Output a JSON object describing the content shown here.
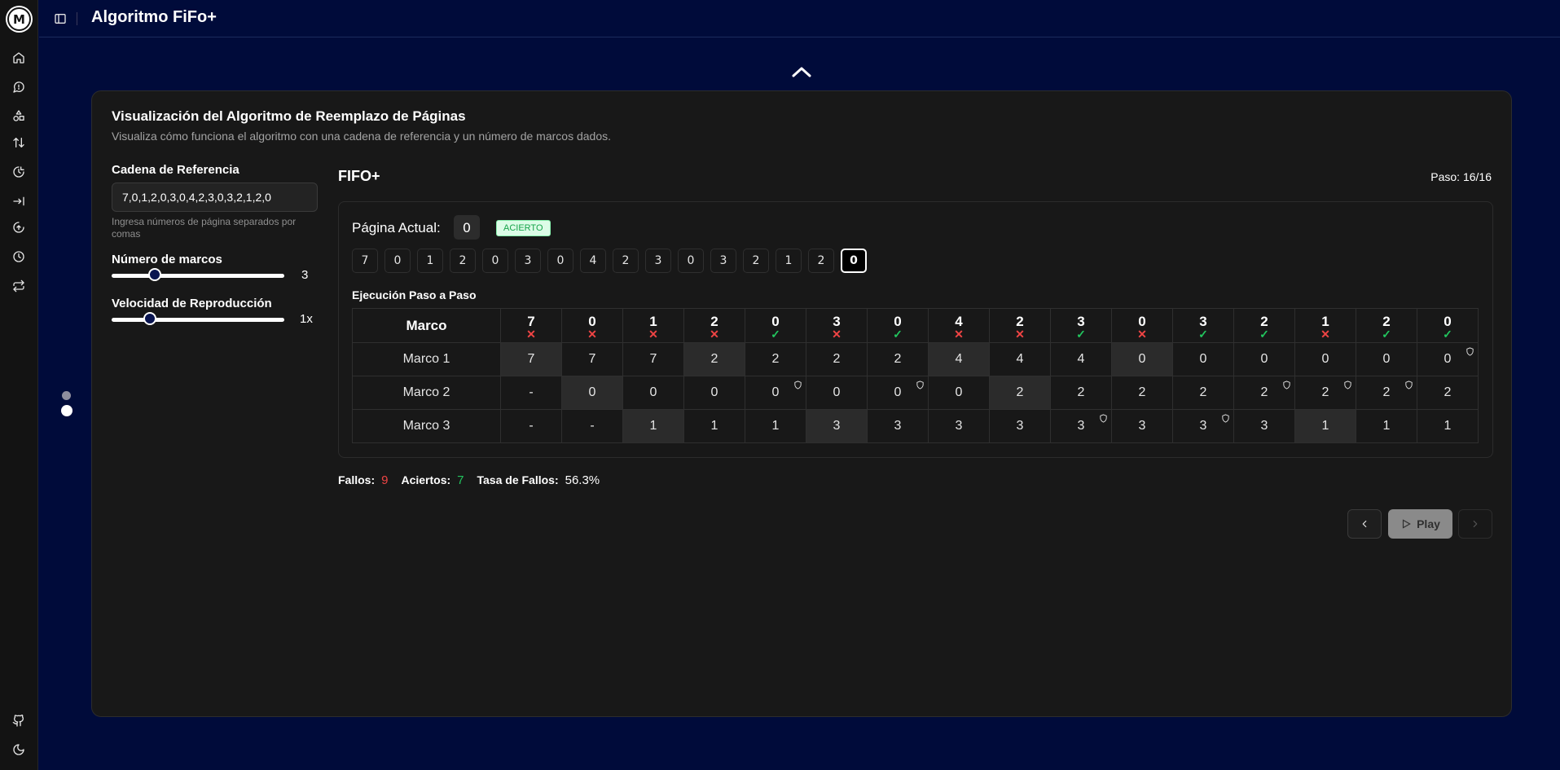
{
  "app": {
    "title": "Algoritmo FiFo+",
    "logo": "M"
  },
  "sidebar": {
    "items": [
      {
        "icon": "home-icon"
      },
      {
        "icon": "chat-icon"
      },
      {
        "icon": "shapes-icon"
      },
      {
        "icon": "swap-vertical-icon"
      },
      {
        "icon": "clock-pie-icon"
      },
      {
        "icon": "arrow-right-to-line-icon"
      },
      {
        "icon": "upload-clock-icon"
      },
      {
        "icon": "clock-icon"
      },
      {
        "icon": "repeat-icon"
      }
    ],
    "bottom": [
      {
        "icon": "github-icon"
      },
      {
        "icon": "moon-icon"
      }
    ]
  },
  "card": {
    "title": "Visualización del Algoritmo de Reemplazo de Páginas",
    "description": "Visualiza cómo funciona el algoritmo con una cadena de referencia y un número de marcos dados."
  },
  "controls": {
    "ref_label": "Cadena de Referencia",
    "ref_value": "7,0,1,2,0,3,0,4,2,3,0,3,2,1,2,0",
    "ref_hint": "Ingresa números de página separados por comas",
    "frames_label": "Número de marcos",
    "frames_value": "3",
    "frames_fraction": 0.25,
    "speed_label": "Velocidad de Reproducción",
    "speed_value": "1x",
    "speed_fraction": 0.22
  },
  "viz": {
    "algorithm": "FIFO+",
    "step": "Paso: 16/16",
    "current_label": "Página Actual:",
    "current_value": "0",
    "status_badge": "ACIERTO",
    "exec_label": "Ejecución Paso a Paso",
    "sequence": [
      "7",
      "0",
      "1",
      "2",
      "0",
      "3",
      "0",
      "4",
      "2",
      "3",
      "0",
      "3",
      "2",
      "1",
      "2",
      "0"
    ],
    "active_index": 15,
    "corner": "Marco",
    "results": [
      "miss",
      "miss",
      "miss",
      "miss",
      "hit",
      "miss",
      "hit",
      "miss",
      "miss",
      "hit",
      "miss",
      "hit",
      "hit",
      "miss",
      "hit",
      "hit"
    ],
    "frames": [
      {
        "name": "Marco 1",
        "values": [
          "7",
          "7",
          "7",
          "2",
          "2",
          "2",
          "2",
          "4",
          "4",
          "4",
          "0",
          "0",
          "0",
          "0",
          "0",
          "0"
        ],
        "highlight": [
          0,
          3,
          7,
          10
        ],
        "shield": [
          15
        ]
      },
      {
        "name": "Marco 2",
        "values": [
          "-",
          "0",
          "0",
          "0",
          "0",
          "0",
          "0",
          "0",
          "2",
          "2",
          "2",
          "2",
          "2",
          "2",
          "2",
          "2"
        ],
        "highlight": [
          1,
          8
        ],
        "shield": [
          4,
          6,
          12,
          13,
          14
        ]
      },
      {
        "name": "Marco 3",
        "values": [
          "-",
          "-",
          "1",
          "1",
          "1",
          "3",
          "3",
          "3",
          "3",
          "3",
          "3",
          "3",
          "3",
          "1",
          "1",
          "1"
        ],
        "highlight": [
          2,
          5,
          13
        ],
        "shield": [
          9,
          11
        ]
      }
    ]
  },
  "stats": {
    "faults_label": "Fallos:",
    "faults": "9",
    "hits_label": "Aciertos:",
    "hits": "7",
    "rate_label": "Tasa de Fallos:",
    "rate": "56.3%"
  },
  "player": {
    "play_label": "Play"
  }
}
